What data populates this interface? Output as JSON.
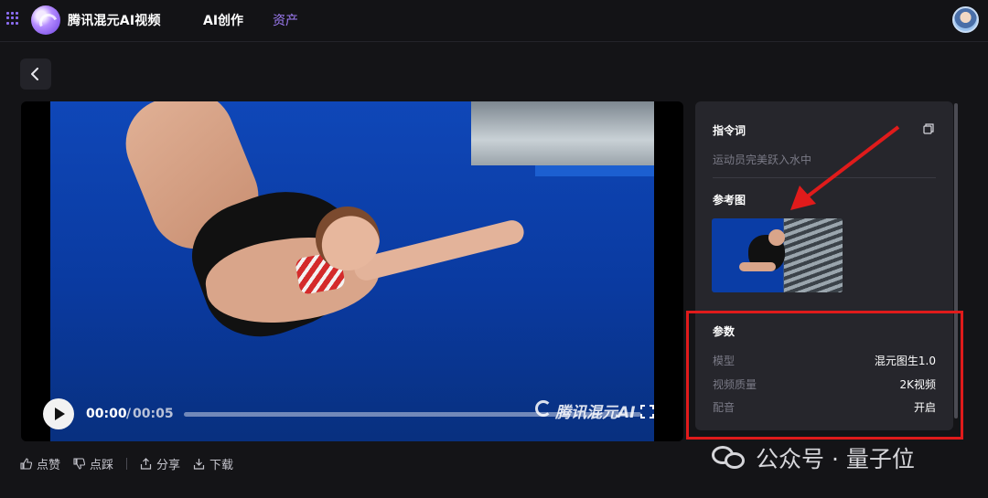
{
  "header": {
    "brand": "腾讯混元AI视频",
    "nav": [
      {
        "label": "AI创作",
        "active": true
      },
      {
        "label": "资产",
        "active": false
      }
    ],
    "accent_color": "#9f7cf5"
  },
  "player": {
    "current_time": "00:00",
    "separator": "/",
    "total_time": "00:05",
    "progress": 0,
    "watermark": "腾讯混元AI"
  },
  "actions": [
    {
      "label": "点赞",
      "icon": "thumb-up-icon"
    },
    {
      "label": "点踩",
      "icon": "thumb-down-icon"
    },
    {
      "label": "分享",
      "icon": "share-icon"
    },
    {
      "label": "下载",
      "icon": "download-icon"
    }
  ],
  "details": {
    "prompt_title": "指令词",
    "prompt_text": "运动员完美跃入水中",
    "reference_title": "参考图",
    "params_title": "参数",
    "params": [
      {
        "key": "模型",
        "value": "混元图生1.0"
      },
      {
        "key": "视频质量",
        "value": "2K视频"
      },
      {
        "key": "配音",
        "value": "开启"
      }
    ]
  },
  "annotation_color": "#e01b1b",
  "overlay_watermark": "公众号 · 量子位"
}
